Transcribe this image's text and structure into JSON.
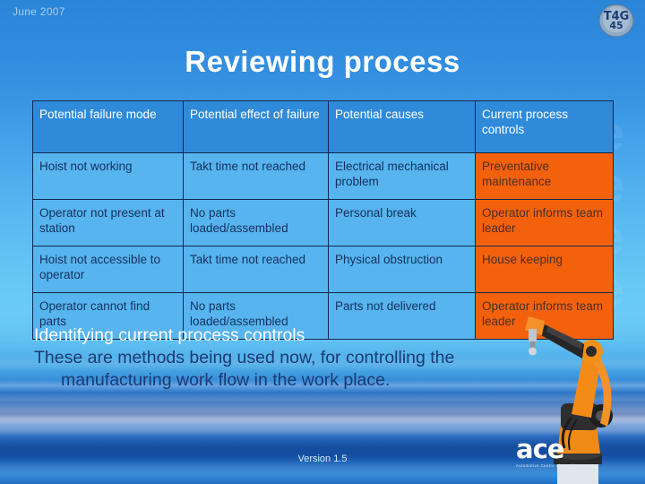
{
  "header": {
    "date": "June 2007",
    "logo_alt": "T4G",
    "title": "Reviewing process"
  },
  "table": {
    "columns": [
      "Potential failure mode",
      "Potential effect of failure",
      "Potential causes",
      "Current process controls"
    ],
    "rows": [
      {
        "failure_mode": "Hoist not working",
        "effect": "Takt time not reached",
        "cause": "Electrical mechanical problem",
        "control": "Preventative maintenance"
      },
      {
        "failure_mode": "Operator not present at station",
        "effect": "No parts loaded/assembled",
        "cause": "Personal break",
        "control": "Operator informs team leader"
      },
      {
        "failure_mode": "Hoist not accessible to operator",
        "effect": "Takt time not reached",
        "cause": "Physical obstruction",
        "control": "House keeping"
      },
      {
        "failure_mode": "Operator cannot find parts",
        "effect": "No parts loaded/assembled",
        "cause": "Parts not delivered",
        "control": "Operator informs team leader"
      }
    ]
  },
  "body": {
    "lead": "Identifying current process controls",
    "line1": "These are methods being used now, for controlling the",
    "line2": "manufacturing work flow in the work place."
  },
  "footer": {
    "version": "Version 1.5",
    "ace_word": "ace",
    "ace_tagline": "Automotive Centre of Excellence"
  },
  "colors": {
    "header_cell": "#2f8ad9",
    "body_cell_blue": "#57b4ee",
    "body_cell_orange": "#f4610d",
    "title_text": "#ffffff",
    "body_text_dark": "#1b3a73"
  },
  "watermark_text": "ace ace"
}
